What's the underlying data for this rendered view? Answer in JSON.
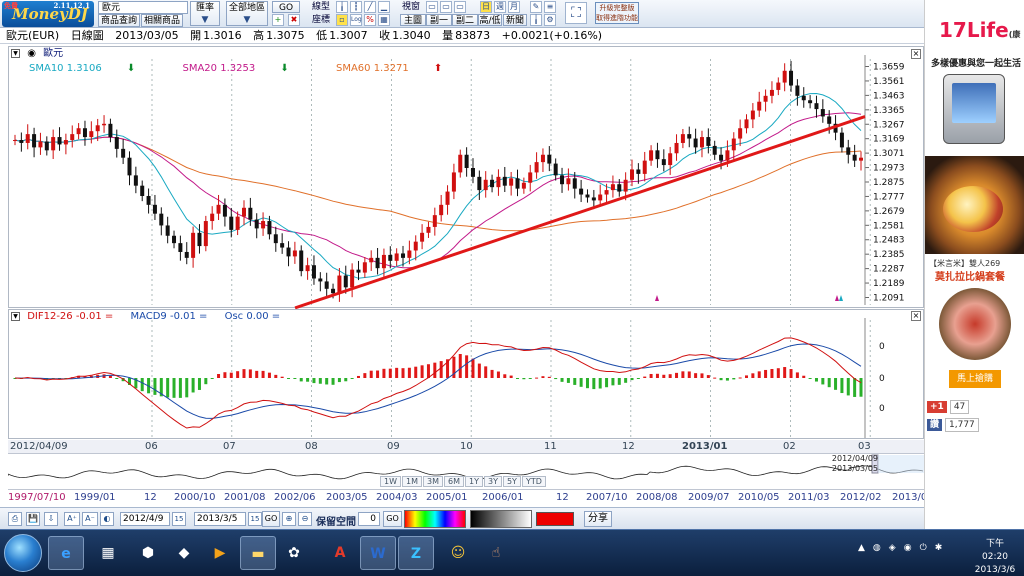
{
  "toolbar": {
    "logo": "MoneyDJ",
    "logo_version": "2.11.12.1",
    "logo_tag": "免費",
    "product_field": "歐元",
    "product_query": "商品查詢",
    "related_products": "相關商品",
    "exchange_label": "匯率",
    "all_regions": "全部地區",
    "go": "GO",
    "line_type": "線型",
    "coordinates": "座標",
    "view": "視窗",
    "main_label": "主圖",
    "sub1_label": "副一",
    "sub2_label": "副二",
    "day": "日",
    "week": "週",
    "month": "月",
    "high_low": "高/低",
    "news": "新聞",
    "log_label": "Log",
    "percent_label": "%",
    "promo": "升級完整版 取得進階功能"
  },
  "info": {
    "symbol": "歐元(EUR)",
    "chart_type": "日線圖",
    "date": "2013/03/05",
    "open_label": "開",
    "open": "1.3016",
    "high_label": "高",
    "high": "1.3075",
    "low_label": "低",
    "low": "1.3007",
    "close_label": "收",
    "close": "1.3040",
    "volume_label": "量",
    "volume": "83873",
    "change": "+0.0021(+0.16%)"
  },
  "price_panel": {
    "name": "歐元",
    "sma10_label": "SMA10 1.3106",
    "sma20_label": "SMA20 1.3253",
    "sma60_label": "SMA60 1.3271",
    "close_x": "×"
  },
  "macd_panel": {
    "dif_label": "DIF12-26 -0.01 =",
    "macd_label": "MACD9 -0.01 =",
    "osc_label": "Osc 0.00 =",
    "close_x": "×"
  },
  "time_axis": {
    "start": "2012/04/09",
    "months": [
      "06",
      "07",
      "08",
      "09",
      "10",
      "11",
      "12",
      "2013/01",
      "02",
      "03"
    ]
  },
  "overview": {
    "date_from": "2012/04/09",
    "date_to": "2013/03/05",
    "periods": [
      "1W",
      "1M",
      "3M",
      "6M",
      "1Y",
      "3Y",
      "5Y",
      "YTD"
    ]
  },
  "year_axis": {
    "start": "1997/07/10",
    "labels": [
      "1999/01",
      "12",
      "2000/10",
      "2001/08",
      "2002/06",
      "2003/05",
      "2004/03",
      "2005/01",
      "2006/01",
      "12",
      "2007/10",
      "2008/08",
      "2009/07",
      "2010/05",
      "2011/03",
      "2012/02",
      "2013/0"
    ]
  },
  "bottom": {
    "start_date": "2012/4/9",
    "start_days": "15",
    "end_date": "2013/3/5",
    "end_days": "15",
    "go": "GO",
    "keep_space": "保留空間",
    "space_value": "0",
    "go2": "GO",
    "share": "分享",
    "swatch_color": "#ee0000"
  },
  "ad": {
    "logo": "17Life",
    "logo_sub": "(康",
    "slogan": "多樣優惠與您一起生活",
    "promo_title": "【米言米】雙人269",
    "promo_name": "莫扎拉比鍋套餐",
    "cta": "馬上搶購",
    "gplus": "+1",
    "gplus_count": "47",
    "fb": "讚",
    "fb_count": "1,777"
  },
  "taskbar": {
    "clock_time": "下午 02:20",
    "clock_date": "2013/3/6"
  },
  "chart_data": {
    "type": "candlestick",
    "yticks": [
      1.3659,
      1.3561,
      1.3463,
      1.3365,
      1.3267,
      1.3169,
      1.3071,
      1.2973,
      1.2875,
      1.2777,
      1.2679,
      1.2581,
      1.2483,
      1.2385,
      1.2287,
      1.2189,
      1.2091
    ],
    "ylim": [
      1.204,
      1.371
    ],
    "closes": [
      1.316,
      1.314,
      1.32,
      1.311,
      1.315,
      1.309,
      1.318,
      1.313,
      1.316,
      1.32,
      1.324,
      1.318,
      1.322,
      1.326,
      1.327,
      1.318,
      1.31,
      1.304,
      1.292,
      1.285,
      1.278,
      1.272,
      1.266,
      1.258,
      1.251,
      1.246,
      1.24,
      1.236,
      1.253,
      1.244,
      1.261,
      1.266,
      1.272,
      1.264,
      1.255,
      1.264,
      1.27,
      1.262,
      1.256,
      1.261,
      1.252,
      1.246,
      1.243,
      1.237,
      1.241,
      1.227,
      1.231,
      1.222,
      1.22,
      1.215,
      1.212,
      1.224,
      1.216,
      1.228,
      1.226,
      1.233,
      1.236,
      1.229,
      1.238,
      1.234,
      1.239,
      1.236,
      1.241,
      1.247,
      1.253,
      1.257,
      1.265,
      1.272,
      1.281,
      1.294,
      1.306,
      1.297,
      1.291,
      1.282,
      1.289,
      1.284,
      1.291,
      1.285,
      1.29,
      1.283,
      1.287,
      1.294,
      1.301,
      1.306,
      1.3,
      1.292,
      1.286,
      1.29,
      1.283,
      1.279,
      1.277,
      1.275,
      1.279,
      1.282,
      1.286,
      1.281,
      1.289,
      1.296,
      1.293,
      1.302,
      1.309,
      1.303,
      1.299,
      1.307,
      1.314,
      1.32,
      1.317,
      1.311,
      1.318,
      1.312,
      1.306,
      1.302,
      1.309,
      1.317,
      1.324,
      1.33,
      1.336,
      1.342,
      1.346,
      1.35,
      1.355,
      1.363,
      1.353,
      1.346,
      1.343,
      1.341,
      1.337,
      1.332,
      1.327,
      1.321,
      1.311,
      1.306,
      1.302,
      1.304
    ],
    "sma10_last": 1.3106,
    "sma20_last": 1.3253,
    "sma60_last": 1.3271,
    "trendline": [
      [
        1.212,
        50
      ],
      [
        1.331,
        133
      ]
    ],
    "macd_yticks": [
      0,
      0,
      0
    ]
  }
}
